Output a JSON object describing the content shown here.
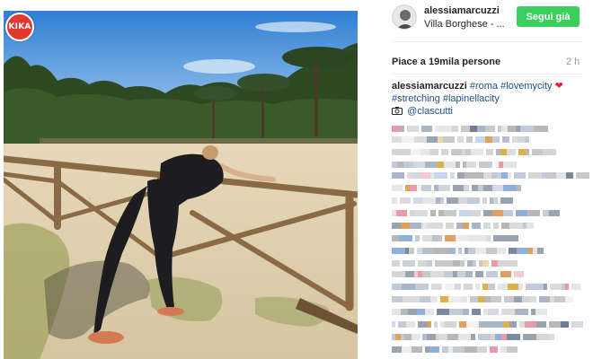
{
  "watermark": {
    "label": "KIKA"
  },
  "post": {
    "username": "alessiamarcuzzi",
    "location": "Villa Borghese - ...",
    "follow_label": "Segui già",
    "likes": "Piace a 19mila persone",
    "time": "2 h",
    "caption": {
      "author": "alessiamarcuzzi",
      "tags_line1": [
        "#roma",
        "#lovemycity"
      ],
      "tags_line2": [
        "#stretching",
        "#lapinellacity"
      ],
      "mention": "@clascutti"
    }
  },
  "colors": {
    "follow_button": "#3ccf5e",
    "hashtag": "#1f4f82",
    "heart": "#e0243b"
  },
  "icons": {
    "heart": "heart-icon",
    "camera": "camera-icon"
  }
}
